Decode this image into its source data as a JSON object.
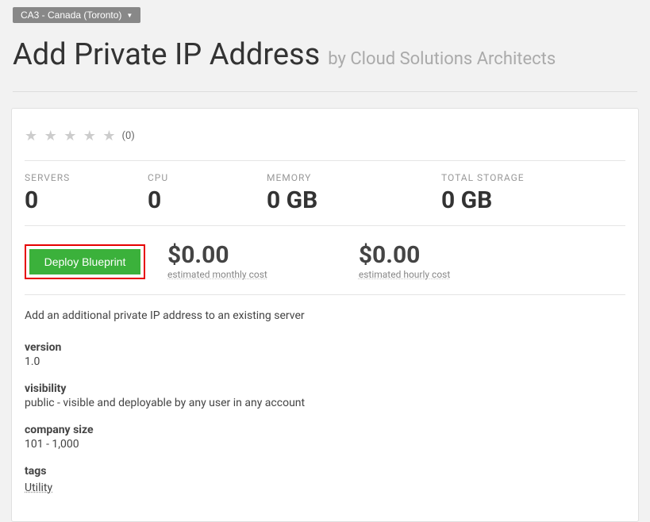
{
  "region": "CA3 - Canada (Toronto)",
  "header": {
    "title": "Add Private IP Address",
    "by_label": "by",
    "author": "Cloud Solutions Architects"
  },
  "rating": {
    "stars_glyphs": "★ ★ ★ ★ ★",
    "count": "(0)"
  },
  "stats": {
    "servers_label": "SERVERS",
    "servers_value": "0",
    "cpu_label": "CPU",
    "cpu_value": "0",
    "memory_label": "MEMORY",
    "memory_value": "0 GB",
    "storage_label": "TOTAL STORAGE",
    "storage_value": "0 GB"
  },
  "deploy": {
    "button_label": "Deploy Blueprint",
    "monthly_cost": "$0.00",
    "monthly_label": "estimated monthly cost",
    "hourly_cost": "$0.00",
    "hourly_label": "estimated hourly cost"
  },
  "description": "Add an additional private IP address to an existing server",
  "meta": {
    "version_label": "version",
    "version_value": "1.0",
    "visibility_label": "visibility",
    "visibility_value": "public - visible and deployable by any user in any account",
    "company_size_label": "company size",
    "company_size_value": "101 - 1,000",
    "tags_label": "tags",
    "tags_value": "Utility"
  }
}
